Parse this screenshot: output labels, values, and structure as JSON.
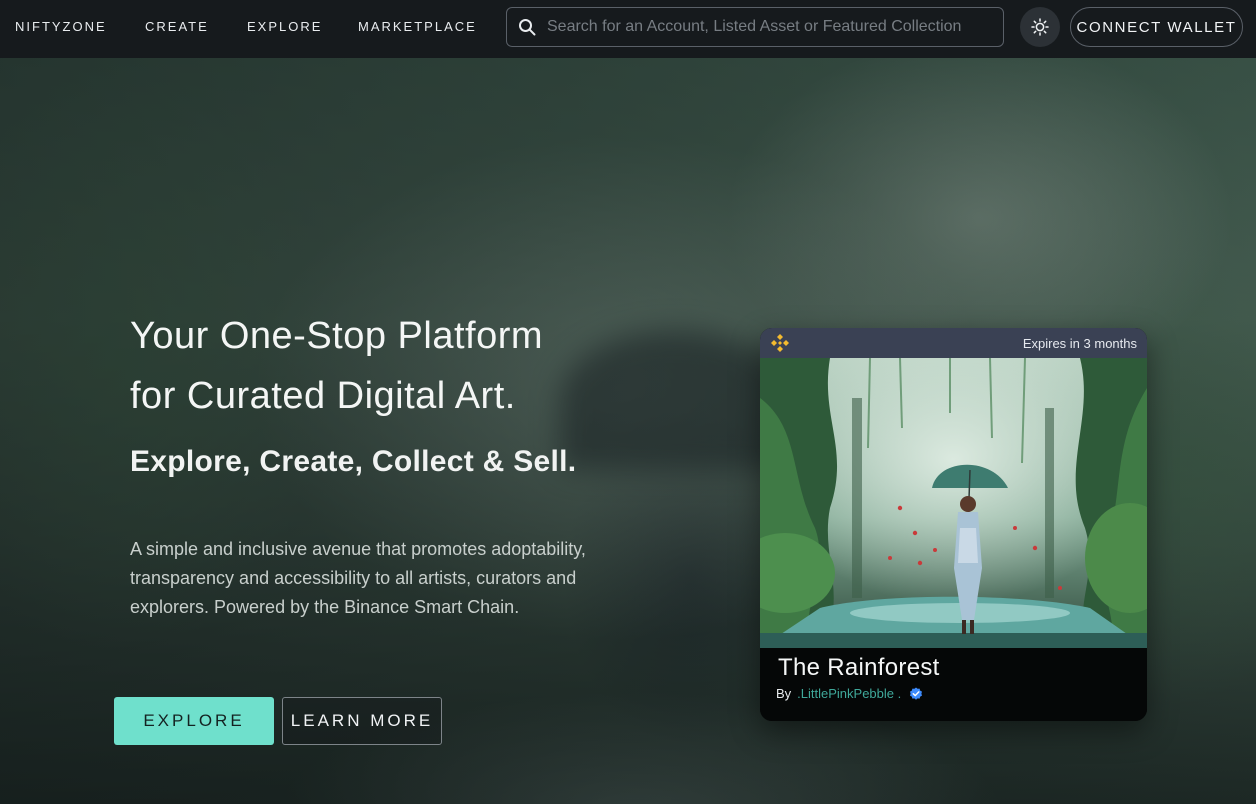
{
  "nav": {
    "brand": "NIFTYZONE",
    "links": [
      "CREATE",
      "EXPLORE",
      "MARKETPLACE"
    ],
    "search": {
      "placeholder": "Search for an Account, Listed Asset or Featured Collection",
      "value": "",
      "icon": "search-icon"
    },
    "theme_toggle_icon": "sun-icon",
    "connect_wallet_label": "CONNECT WALLET"
  },
  "hero": {
    "title_line1": "Your One-Stop Platform",
    "title_line2": "for Curated Digital Art.",
    "subtitle": "Explore, Create, Collect & Sell.",
    "description": "A simple and inclusive avenue that promotes adoptability, transparency and accessibility to all artists, curators and explorers. Powered by the Binance Smart Chain.",
    "explore_label": "EXPLORE",
    "learn_more_label": "LEARN MORE"
  },
  "featured_card": {
    "chain_icon": "binance-icon",
    "expiry": "Expires in 3 months",
    "title": "The Rainforest",
    "by_label": "By",
    "creator": ".LittlePinkPebble .",
    "verified_icon": "verified-badge-icon"
  },
  "colors": {
    "accent": "#6fe0cc",
    "nav_bg": "#161a1d",
    "card_header": "#3a4154",
    "creator_link": "#3fa89a",
    "binance_gold": "#f3ba2f",
    "verified_blue": "#3d8bfd"
  }
}
